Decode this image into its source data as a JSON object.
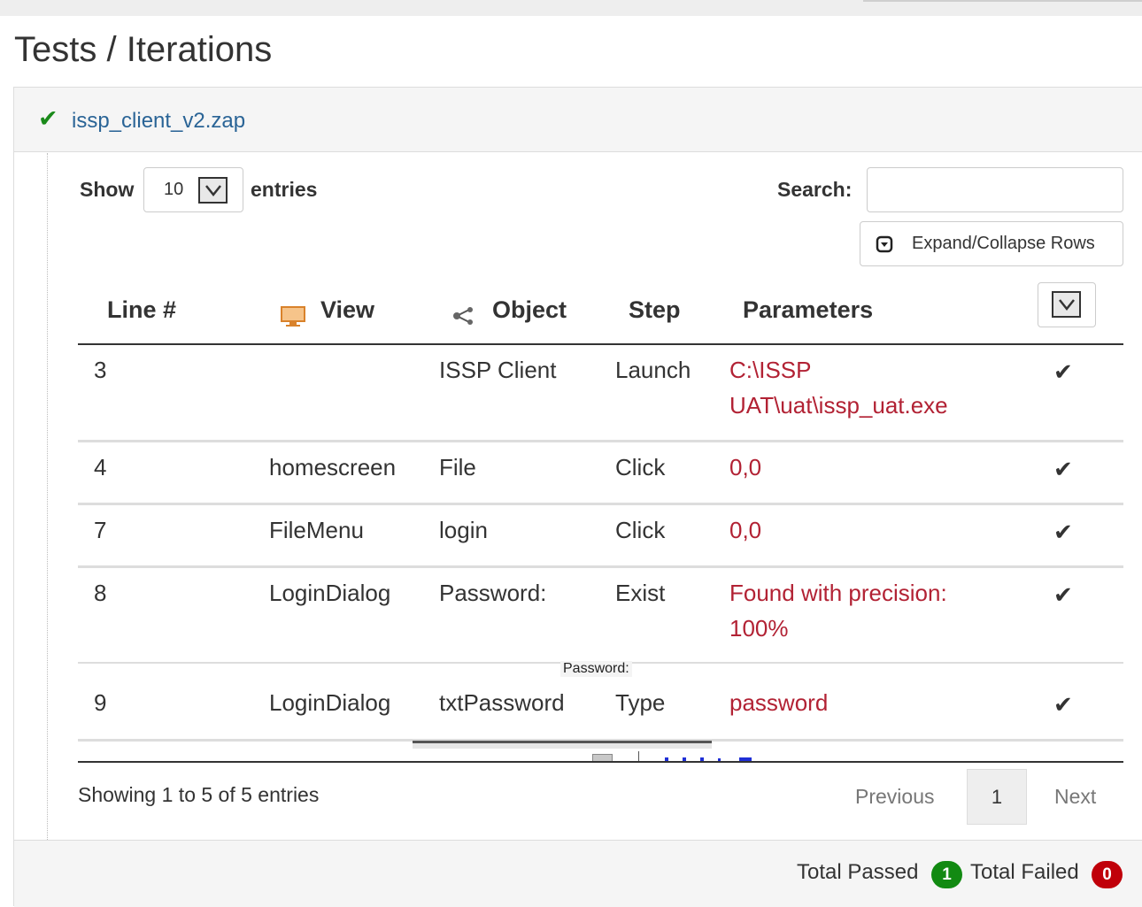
{
  "page": {
    "title": "Tests / Iterations"
  },
  "panel": {
    "file_name": "issp_client_v2.zap"
  },
  "table_controls": {
    "show_label": "Show",
    "page_length": "10",
    "entries_label": "entries",
    "search_label": "Search:",
    "search_value": "",
    "expand_collapse_label": "Expand/Collapse Rows"
  },
  "columns": {
    "line": "Line #",
    "view": "View",
    "object": "Object",
    "step": "Step",
    "parameters": "Parameters"
  },
  "rows": [
    {
      "line": "3",
      "view": "",
      "object": "ISSP Client",
      "step": "Launch",
      "parameters": "C:\\ISSP UAT\\uat\\issp_uat.exe",
      "status": "passed"
    },
    {
      "line": "4",
      "view": "homescreen",
      "object": "File",
      "step": "Click",
      "parameters": "0,0",
      "status": "passed"
    },
    {
      "line": "7",
      "view": "FileMenu",
      "object": "login",
      "step": "Click",
      "parameters": "0,0",
      "status": "passed"
    },
    {
      "line": "8",
      "view": "LoginDialog",
      "object": "Password:",
      "step": "Exist",
      "parameters": "Found with precision: 100%",
      "status": "passed"
    },
    {
      "line": "9",
      "view": "LoginDialog",
      "object": "txtPassword",
      "step": "Type",
      "parameters": "password",
      "status": "passed"
    }
  ],
  "tooltip": "Password:",
  "pagination": {
    "info": "Showing 1 to 5 of 5 entries",
    "previous": "Previous",
    "current_page": "1",
    "next": "Next"
  },
  "summary": {
    "passed_label": "Total Passed",
    "passed_count": "1",
    "failed_label": "Total Failed",
    "failed_count": "0"
  },
  "colors": {
    "link": "#2a6496",
    "param_text": "#b22234",
    "success": "#128a12",
    "danger": "#c0000a"
  }
}
